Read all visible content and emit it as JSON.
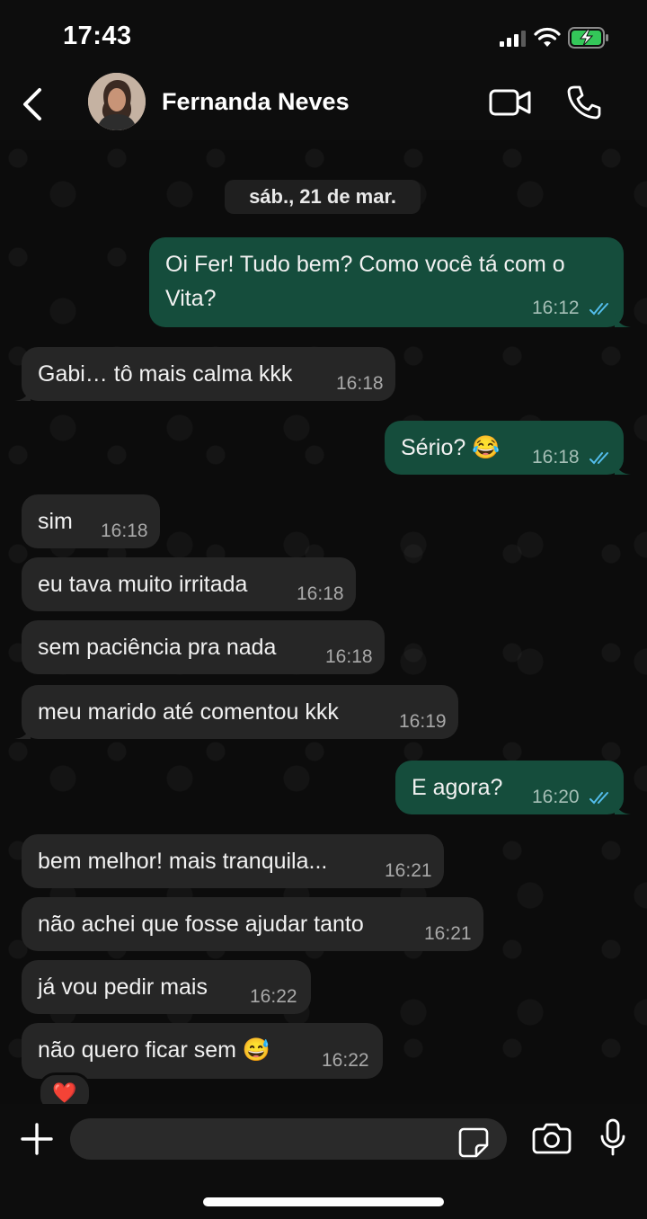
{
  "status_bar": {
    "time": "17:43"
  },
  "header": {
    "contact_name": "Fernanda Neves"
  },
  "chat": {
    "date": "sáb., 21 de mar.",
    "messages": [
      {
        "dir": "out",
        "text": "Oi Fer! Tudo bem? Como você tá com o",
        "text2": "Vita?",
        "time": "16:12",
        "read": true
      },
      {
        "dir": "in",
        "text": "Gabi… tô mais calma kkk",
        "time": "16:18"
      },
      {
        "dir": "out",
        "text": "Sério? 😂",
        "time": "16:18",
        "read": true
      },
      {
        "dir": "in",
        "text": "sim",
        "time": "16:18"
      },
      {
        "dir": "in",
        "text": "eu tava muito irritada",
        "time": "16:18"
      },
      {
        "dir": "in",
        "text": "sem paciência pra nada",
        "time": "16:18"
      },
      {
        "dir": "in",
        "text": "meu marido até comentou kkk",
        "time": "16:19"
      },
      {
        "dir": "out",
        "text": "E agora?",
        "time": "16:20",
        "read": true
      },
      {
        "dir": "in",
        "text": "bem melhor! mais tranquila...",
        "time": "16:21"
      },
      {
        "dir": "in",
        "text": "não achei que fosse ajudar tanto",
        "time": "16:21"
      },
      {
        "dir": "in",
        "text": "já vou pedir mais",
        "time": "16:22"
      },
      {
        "dir": "in",
        "text": "não quero ficar sem 😅",
        "time": "16:22"
      }
    ],
    "reaction": "❤️"
  },
  "colors": {
    "outgoing_bubble": "#154d3c",
    "incoming_bubble": "#262626",
    "read_tick": "#53bdeb"
  },
  "icons": [
    "back-icon",
    "video-call-icon",
    "phone-icon",
    "plus-icon",
    "sticker-icon",
    "camera-icon",
    "microphone-icon"
  ]
}
